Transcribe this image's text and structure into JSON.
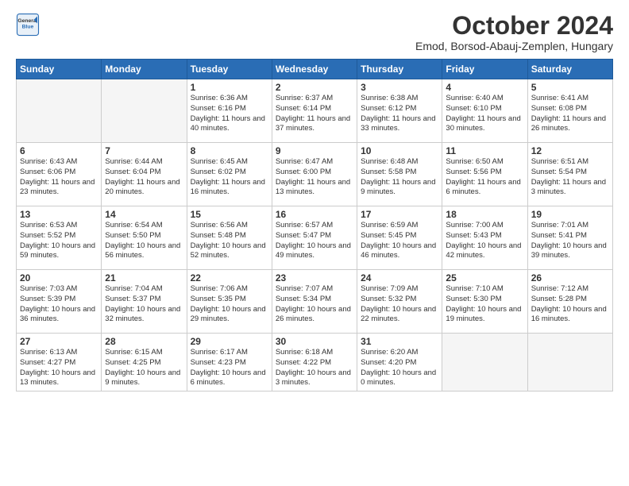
{
  "header": {
    "logo_line1": "General",
    "logo_line2": "Blue",
    "title": "October 2024",
    "subtitle": "Emod, Borsod-Abauj-Zemplen, Hungary"
  },
  "days_of_week": [
    "Sunday",
    "Monday",
    "Tuesday",
    "Wednesday",
    "Thursday",
    "Friday",
    "Saturday"
  ],
  "weeks": [
    [
      {
        "day": "",
        "info": ""
      },
      {
        "day": "",
        "info": ""
      },
      {
        "day": "1",
        "info": "Sunrise: 6:36 AM\nSunset: 6:16 PM\nDaylight: 11 hours and 40 minutes."
      },
      {
        "day": "2",
        "info": "Sunrise: 6:37 AM\nSunset: 6:14 PM\nDaylight: 11 hours and 37 minutes."
      },
      {
        "day": "3",
        "info": "Sunrise: 6:38 AM\nSunset: 6:12 PM\nDaylight: 11 hours and 33 minutes."
      },
      {
        "day": "4",
        "info": "Sunrise: 6:40 AM\nSunset: 6:10 PM\nDaylight: 11 hours and 30 minutes."
      },
      {
        "day": "5",
        "info": "Sunrise: 6:41 AM\nSunset: 6:08 PM\nDaylight: 11 hours and 26 minutes."
      }
    ],
    [
      {
        "day": "6",
        "info": "Sunrise: 6:43 AM\nSunset: 6:06 PM\nDaylight: 11 hours and 23 minutes."
      },
      {
        "day": "7",
        "info": "Sunrise: 6:44 AM\nSunset: 6:04 PM\nDaylight: 11 hours and 20 minutes."
      },
      {
        "day": "8",
        "info": "Sunrise: 6:45 AM\nSunset: 6:02 PM\nDaylight: 11 hours and 16 minutes."
      },
      {
        "day": "9",
        "info": "Sunrise: 6:47 AM\nSunset: 6:00 PM\nDaylight: 11 hours and 13 minutes."
      },
      {
        "day": "10",
        "info": "Sunrise: 6:48 AM\nSunset: 5:58 PM\nDaylight: 11 hours and 9 minutes."
      },
      {
        "day": "11",
        "info": "Sunrise: 6:50 AM\nSunset: 5:56 PM\nDaylight: 11 hours and 6 minutes."
      },
      {
        "day": "12",
        "info": "Sunrise: 6:51 AM\nSunset: 5:54 PM\nDaylight: 11 hours and 3 minutes."
      }
    ],
    [
      {
        "day": "13",
        "info": "Sunrise: 6:53 AM\nSunset: 5:52 PM\nDaylight: 10 hours and 59 minutes."
      },
      {
        "day": "14",
        "info": "Sunrise: 6:54 AM\nSunset: 5:50 PM\nDaylight: 10 hours and 56 minutes."
      },
      {
        "day": "15",
        "info": "Sunrise: 6:56 AM\nSunset: 5:48 PM\nDaylight: 10 hours and 52 minutes."
      },
      {
        "day": "16",
        "info": "Sunrise: 6:57 AM\nSunset: 5:47 PM\nDaylight: 10 hours and 49 minutes."
      },
      {
        "day": "17",
        "info": "Sunrise: 6:59 AM\nSunset: 5:45 PM\nDaylight: 10 hours and 46 minutes."
      },
      {
        "day": "18",
        "info": "Sunrise: 7:00 AM\nSunset: 5:43 PM\nDaylight: 10 hours and 42 minutes."
      },
      {
        "day": "19",
        "info": "Sunrise: 7:01 AM\nSunset: 5:41 PM\nDaylight: 10 hours and 39 minutes."
      }
    ],
    [
      {
        "day": "20",
        "info": "Sunrise: 7:03 AM\nSunset: 5:39 PM\nDaylight: 10 hours and 36 minutes."
      },
      {
        "day": "21",
        "info": "Sunrise: 7:04 AM\nSunset: 5:37 PM\nDaylight: 10 hours and 32 minutes."
      },
      {
        "day": "22",
        "info": "Sunrise: 7:06 AM\nSunset: 5:35 PM\nDaylight: 10 hours and 29 minutes."
      },
      {
        "day": "23",
        "info": "Sunrise: 7:07 AM\nSunset: 5:34 PM\nDaylight: 10 hours and 26 minutes."
      },
      {
        "day": "24",
        "info": "Sunrise: 7:09 AM\nSunset: 5:32 PM\nDaylight: 10 hours and 22 minutes."
      },
      {
        "day": "25",
        "info": "Sunrise: 7:10 AM\nSunset: 5:30 PM\nDaylight: 10 hours and 19 minutes."
      },
      {
        "day": "26",
        "info": "Sunrise: 7:12 AM\nSunset: 5:28 PM\nDaylight: 10 hours and 16 minutes."
      }
    ],
    [
      {
        "day": "27",
        "info": "Sunrise: 6:13 AM\nSunset: 4:27 PM\nDaylight: 10 hours and 13 minutes."
      },
      {
        "day": "28",
        "info": "Sunrise: 6:15 AM\nSunset: 4:25 PM\nDaylight: 10 hours and 9 minutes."
      },
      {
        "day": "29",
        "info": "Sunrise: 6:17 AM\nSunset: 4:23 PM\nDaylight: 10 hours and 6 minutes."
      },
      {
        "day": "30",
        "info": "Sunrise: 6:18 AM\nSunset: 4:22 PM\nDaylight: 10 hours and 3 minutes."
      },
      {
        "day": "31",
        "info": "Sunrise: 6:20 AM\nSunset: 4:20 PM\nDaylight: 10 hours and 0 minutes."
      },
      {
        "day": "",
        "info": ""
      },
      {
        "day": "",
        "info": ""
      }
    ]
  ]
}
